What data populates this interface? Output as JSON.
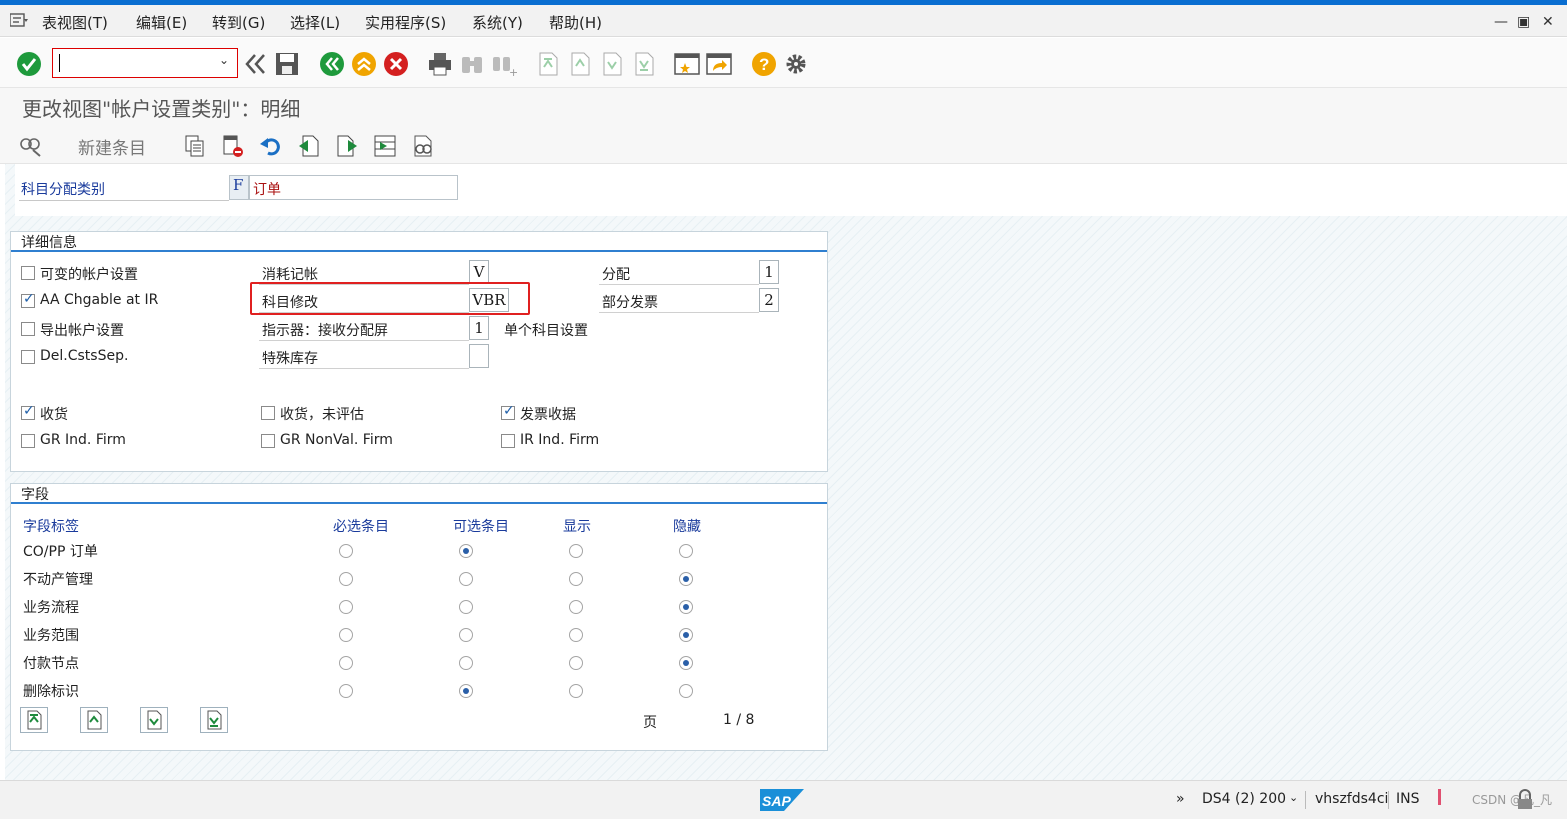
{
  "menu": {
    "items": [
      "表视图(T)",
      "编辑(E)",
      "转到(G)",
      "选择(L)",
      "实用程序(S)",
      "系统(Y)",
      "帮助(H)"
    ]
  },
  "window_controls": {
    "minimize": "—",
    "maximize": "▣",
    "close": "✕"
  },
  "toolbar": {
    "command_field_value": "",
    "icons": [
      "enter-icon",
      "back-double-icon",
      "save-icon",
      "back-icon",
      "exit-icon",
      "cancel-icon",
      "print-icon",
      "find-icon",
      "find-next-icon",
      "first-page-icon",
      "previous-page-icon",
      "next-page-icon",
      "last-page-icon",
      "create-session-icon",
      "shortcut-icon",
      "help-icon",
      "settings-icon"
    ]
  },
  "title": "更改视图\"帐户设置类别\"：明细",
  "app_toolbar": {
    "new_entry": "新建条目"
  },
  "header_field": {
    "label": "科目分配类别",
    "code": "F",
    "description": "订单"
  },
  "detail_group": {
    "title": "详细信息",
    "checkboxes_left": [
      {
        "label": "可变的帐户设置",
        "checked": false
      },
      {
        "label": "AA Chgable at IR",
        "checked": true
      },
      {
        "label": "导出帐户设置",
        "checked": false
      },
      {
        "label": "Del.CstsSep.",
        "checked": false
      }
    ],
    "fields_mid": [
      {
        "label": "消耗记帐",
        "value": "V"
      },
      {
        "label": "科目修改",
        "value": "VBR"
      },
      {
        "label": "指示器：接收分配屏",
        "value": "1"
      },
      {
        "label": "特殊库存",
        "value": ""
      }
    ],
    "fields_right": [
      {
        "label": "分配",
        "value": "1"
      },
      {
        "label": "部分发票",
        "value": "2"
      }
    ],
    "single_account_label": "单个科目设置",
    "goods_checkboxes": [
      {
        "label": "收货",
        "checked": true
      },
      {
        "label": "收货，未评估",
        "checked": false
      },
      {
        "label": "发票收据",
        "checked": true
      },
      {
        "label": "GR Ind. Firm",
        "checked": false
      },
      {
        "label": "GR NonVal. Firm",
        "checked": false
      },
      {
        "label": "IR Ind. Firm",
        "checked": false
      }
    ]
  },
  "fields_group": {
    "title": "字段",
    "columns": [
      "字段标签",
      "必选条目",
      "可选条目",
      "显示",
      "隐藏"
    ],
    "rows": [
      {
        "label": "CO/PP 订单",
        "selected": 1
      },
      {
        "label": "不动产管理",
        "selected": 3
      },
      {
        "label": "业务流程",
        "selected": 3
      },
      {
        "label": "业务范围",
        "selected": 3
      },
      {
        "label": "付款节点",
        "selected": 3
      },
      {
        "label": "删除标识",
        "selected": 1
      }
    ],
    "page_label": "页",
    "page_value": "1 / 8"
  },
  "status": {
    "logo": "SAP",
    "expand": "»",
    "system": "DS4 (2) 200",
    "host": "vhszfds4ci",
    "mode": "INS",
    "watermark": "CSDN @凡_凡"
  },
  "colors": {
    "accent": "#0a6ed1",
    "label_blue": "#1a3b9c",
    "highlight_red": "#e02020"
  }
}
